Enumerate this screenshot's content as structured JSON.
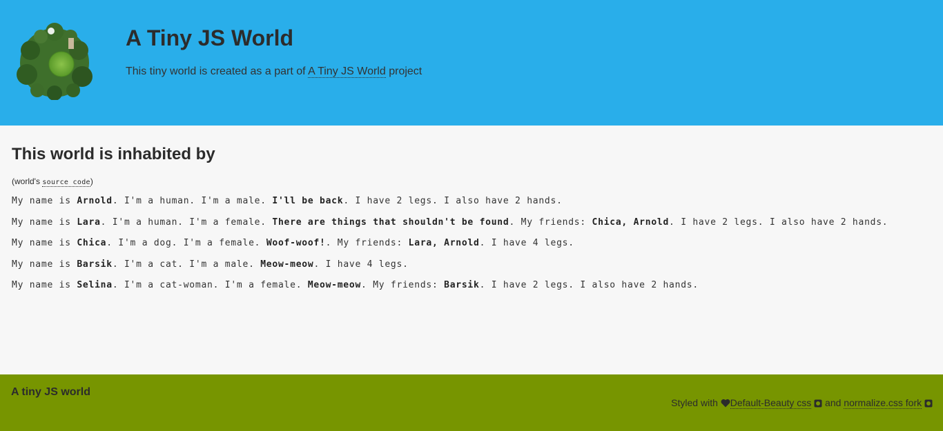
{
  "header": {
    "logo_icon": "tiny-planet-logo",
    "title": "A Tiny JS World",
    "description_prefix": "This tiny world is created as a part of",
    "project_link": "A Tiny JS World",
    "description_suffix": "project"
  },
  "main": {
    "title": "This world is inhabited by",
    "source_prefix": "(world's",
    "source_link": "source code",
    "source_suffix": ")",
    "inhabitants": [
      {
        "p1": "My name is ",
        "name": "Arnold",
        "p2": ". I'm a human. I'm a male. ",
        "saying": "I'll be back",
        "p3": ". I have 2 legs. I also have 2 hands.",
        "friends_label": "",
        "friends": "",
        "p4": ""
      },
      {
        "p1": "My name is ",
        "name": "Lara",
        "p2": ". I'm a human. I'm a female. ",
        "saying": "There are things that shouldn't be found",
        "p3": ". My friends: ",
        "friends": "Chica, Arnold",
        "p4": ". I have 2 legs. I also have 2 hands."
      },
      {
        "p1": "My name is ",
        "name": "Chica",
        "p2": ". I'm a dog. I'm a female. ",
        "saying": "Woof-woof!",
        "p3": ". My friends: ",
        "friends": "Lara, Arnold",
        "p4": ". I have 4 legs."
      },
      {
        "p1": "My name is ",
        "name": "Barsik",
        "p2": ". I'm a cat. I'm a male. ",
        "saying": "Meow-meow",
        "p3": ". I have 4 legs.",
        "friends": "",
        "p4": ""
      },
      {
        "p1": "My name is ",
        "name": "Selina",
        "p2": ". I'm a cat-woman. I'm a female. ",
        "saying": "Meow-meow",
        "p3": ". My friends: ",
        "friends": "Barsik",
        "p4": ". I have 2 legs. I also have 2 hands."
      }
    ]
  },
  "footer": {
    "title": "A tiny JS world",
    "credit_prefix": "Styled with",
    "heart_icon": "heart-icon",
    "link1": "Default-Beauty css",
    "github_icon": "github-icon",
    "and": "and",
    "link2": "normalize.css fork"
  },
  "colors": {
    "header_bg": "#29aeea",
    "main_bg": "#f7f7f7",
    "footer_bg": "#779500"
  }
}
